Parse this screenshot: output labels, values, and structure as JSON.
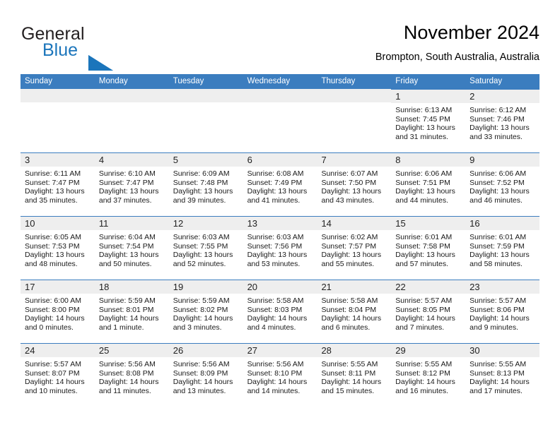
{
  "brand": {
    "name_part1": "General",
    "name_part2": "Blue",
    "triangle_color": "#1b75bb"
  },
  "header": {
    "title": "November 2024",
    "subtitle": "Brompton, South Australia, Australia"
  },
  "colors": {
    "header_bar": "#3b7dbf",
    "date_band": "#eeeeee",
    "brand_blue": "#1b75bb",
    "text": "#000000"
  },
  "weekdays": [
    "Sunday",
    "Monday",
    "Tuesday",
    "Wednesday",
    "Thursday",
    "Friday",
    "Saturday"
  ],
  "weeks": [
    [
      {
        "date": "",
        "empty": true
      },
      {
        "date": "",
        "empty": true
      },
      {
        "date": "",
        "empty": true
      },
      {
        "date": "",
        "empty": true
      },
      {
        "date": "",
        "empty": true
      },
      {
        "date": "1",
        "sunrise": "Sunrise: 6:13 AM",
        "sunset": "Sunset: 7:45 PM",
        "daylight_line1": "Daylight: 13 hours",
        "daylight_line2": "and 31 minutes."
      },
      {
        "date": "2",
        "sunrise": "Sunrise: 6:12 AM",
        "sunset": "Sunset: 7:46 PM",
        "daylight_line1": "Daylight: 13 hours",
        "daylight_line2": "and 33 minutes."
      }
    ],
    [
      {
        "date": "3",
        "sunrise": "Sunrise: 6:11 AM",
        "sunset": "Sunset: 7:47 PM",
        "daylight_line1": "Daylight: 13 hours",
        "daylight_line2": "and 35 minutes."
      },
      {
        "date": "4",
        "sunrise": "Sunrise: 6:10 AM",
        "sunset": "Sunset: 7:47 PM",
        "daylight_line1": "Daylight: 13 hours",
        "daylight_line2": "and 37 minutes."
      },
      {
        "date": "5",
        "sunrise": "Sunrise: 6:09 AM",
        "sunset": "Sunset: 7:48 PM",
        "daylight_line1": "Daylight: 13 hours",
        "daylight_line2": "and 39 minutes."
      },
      {
        "date": "6",
        "sunrise": "Sunrise: 6:08 AM",
        "sunset": "Sunset: 7:49 PM",
        "daylight_line1": "Daylight: 13 hours",
        "daylight_line2": "and 41 minutes."
      },
      {
        "date": "7",
        "sunrise": "Sunrise: 6:07 AM",
        "sunset": "Sunset: 7:50 PM",
        "daylight_line1": "Daylight: 13 hours",
        "daylight_line2": "and 43 minutes."
      },
      {
        "date": "8",
        "sunrise": "Sunrise: 6:06 AM",
        "sunset": "Sunset: 7:51 PM",
        "daylight_line1": "Daylight: 13 hours",
        "daylight_line2": "and 44 minutes."
      },
      {
        "date": "9",
        "sunrise": "Sunrise: 6:06 AM",
        "sunset": "Sunset: 7:52 PM",
        "daylight_line1": "Daylight: 13 hours",
        "daylight_line2": "and 46 minutes."
      }
    ],
    [
      {
        "date": "10",
        "sunrise": "Sunrise: 6:05 AM",
        "sunset": "Sunset: 7:53 PM",
        "daylight_line1": "Daylight: 13 hours",
        "daylight_line2": "and 48 minutes."
      },
      {
        "date": "11",
        "sunrise": "Sunrise: 6:04 AM",
        "sunset": "Sunset: 7:54 PM",
        "daylight_line1": "Daylight: 13 hours",
        "daylight_line2": "and 50 minutes."
      },
      {
        "date": "12",
        "sunrise": "Sunrise: 6:03 AM",
        "sunset": "Sunset: 7:55 PM",
        "daylight_line1": "Daylight: 13 hours",
        "daylight_line2": "and 52 minutes."
      },
      {
        "date": "13",
        "sunrise": "Sunrise: 6:03 AM",
        "sunset": "Sunset: 7:56 PM",
        "daylight_line1": "Daylight: 13 hours",
        "daylight_line2": "and 53 minutes."
      },
      {
        "date": "14",
        "sunrise": "Sunrise: 6:02 AM",
        "sunset": "Sunset: 7:57 PM",
        "daylight_line1": "Daylight: 13 hours",
        "daylight_line2": "and 55 minutes."
      },
      {
        "date": "15",
        "sunrise": "Sunrise: 6:01 AM",
        "sunset": "Sunset: 7:58 PM",
        "daylight_line1": "Daylight: 13 hours",
        "daylight_line2": "and 57 minutes."
      },
      {
        "date": "16",
        "sunrise": "Sunrise: 6:01 AM",
        "sunset": "Sunset: 7:59 PM",
        "daylight_line1": "Daylight: 13 hours",
        "daylight_line2": "and 58 minutes."
      }
    ],
    [
      {
        "date": "17",
        "sunrise": "Sunrise: 6:00 AM",
        "sunset": "Sunset: 8:00 PM",
        "daylight_line1": "Daylight: 14 hours",
        "daylight_line2": "and 0 minutes."
      },
      {
        "date": "18",
        "sunrise": "Sunrise: 5:59 AM",
        "sunset": "Sunset: 8:01 PM",
        "daylight_line1": "Daylight: 14 hours",
        "daylight_line2": "and 1 minute."
      },
      {
        "date": "19",
        "sunrise": "Sunrise: 5:59 AM",
        "sunset": "Sunset: 8:02 PM",
        "daylight_line1": "Daylight: 14 hours",
        "daylight_line2": "and 3 minutes."
      },
      {
        "date": "20",
        "sunrise": "Sunrise: 5:58 AM",
        "sunset": "Sunset: 8:03 PM",
        "daylight_line1": "Daylight: 14 hours",
        "daylight_line2": "and 4 minutes."
      },
      {
        "date": "21",
        "sunrise": "Sunrise: 5:58 AM",
        "sunset": "Sunset: 8:04 PM",
        "daylight_line1": "Daylight: 14 hours",
        "daylight_line2": "and 6 minutes."
      },
      {
        "date": "22",
        "sunrise": "Sunrise: 5:57 AM",
        "sunset": "Sunset: 8:05 PM",
        "daylight_line1": "Daylight: 14 hours",
        "daylight_line2": "and 7 minutes."
      },
      {
        "date": "23",
        "sunrise": "Sunrise: 5:57 AM",
        "sunset": "Sunset: 8:06 PM",
        "daylight_line1": "Daylight: 14 hours",
        "daylight_line2": "and 9 minutes."
      }
    ],
    [
      {
        "date": "24",
        "sunrise": "Sunrise: 5:57 AM",
        "sunset": "Sunset: 8:07 PM",
        "daylight_line1": "Daylight: 14 hours",
        "daylight_line2": "and 10 minutes."
      },
      {
        "date": "25",
        "sunrise": "Sunrise: 5:56 AM",
        "sunset": "Sunset: 8:08 PM",
        "daylight_line1": "Daylight: 14 hours",
        "daylight_line2": "and 11 minutes."
      },
      {
        "date": "26",
        "sunrise": "Sunrise: 5:56 AM",
        "sunset": "Sunset: 8:09 PM",
        "daylight_line1": "Daylight: 14 hours",
        "daylight_line2": "and 13 minutes."
      },
      {
        "date": "27",
        "sunrise": "Sunrise: 5:56 AM",
        "sunset": "Sunset: 8:10 PM",
        "daylight_line1": "Daylight: 14 hours",
        "daylight_line2": "and 14 minutes."
      },
      {
        "date": "28",
        "sunrise": "Sunrise: 5:55 AM",
        "sunset": "Sunset: 8:11 PM",
        "daylight_line1": "Daylight: 14 hours",
        "daylight_line2": "and 15 minutes."
      },
      {
        "date": "29",
        "sunrise": "Sunrise: 5:55 AM",
        "sunset": "Sunset: 8:12 PM",
        "daylight_line1": "Daylight: 14 hours",
        "daylight_line2": "and 16 minutes."
      },
      {
        "date": "30",
        "sunrise": "Sunrise: 5:55 AM",
        "sunset": "Sunset: 8:13 PM",
        "daylight_line1": "Daylight: 14 hours",
        "daylight_line2": "and 17 minutes."
      }
    ]
  ]
}
